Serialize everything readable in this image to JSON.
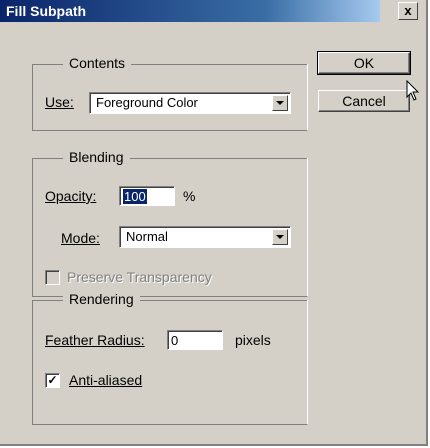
{
  "window": {
    "title": "Fill Subpath",
    "close_label": "x"
  },
  "contents": {
    "group_label": "Contents",
    "use_label": "Use:",
    "use_value": "Foreground Color"
  },
  "blending": {
    "group_label": "Blending",
    "opacity_label": "Opacity:",
    "opacity_value": "100",
    "opacity_unit": "%",
    "mode_label": "Mode:",
    "mode_value": "Normal",
    "preserve_label": "Preserve Transparency",
    "preserve_checked": false,
    "preserve_disabled": true
  },
  "rendering": {
    "group_label": "Rendering",
    "feather_label": "Feather Radius:",
    "feather_value": "0",
    "feather_unit": "pixels",
    "antialias_label": "Anti-aliased",
    "antialias_checked": true
  },
  "buttons": {
    "ok_label": "OK",
    "cancel_label": "Cancel"
  },
  "icons": {
    "checkmark": "✓",
    "cursor": "arrow-pointer-icon"
  }
}
